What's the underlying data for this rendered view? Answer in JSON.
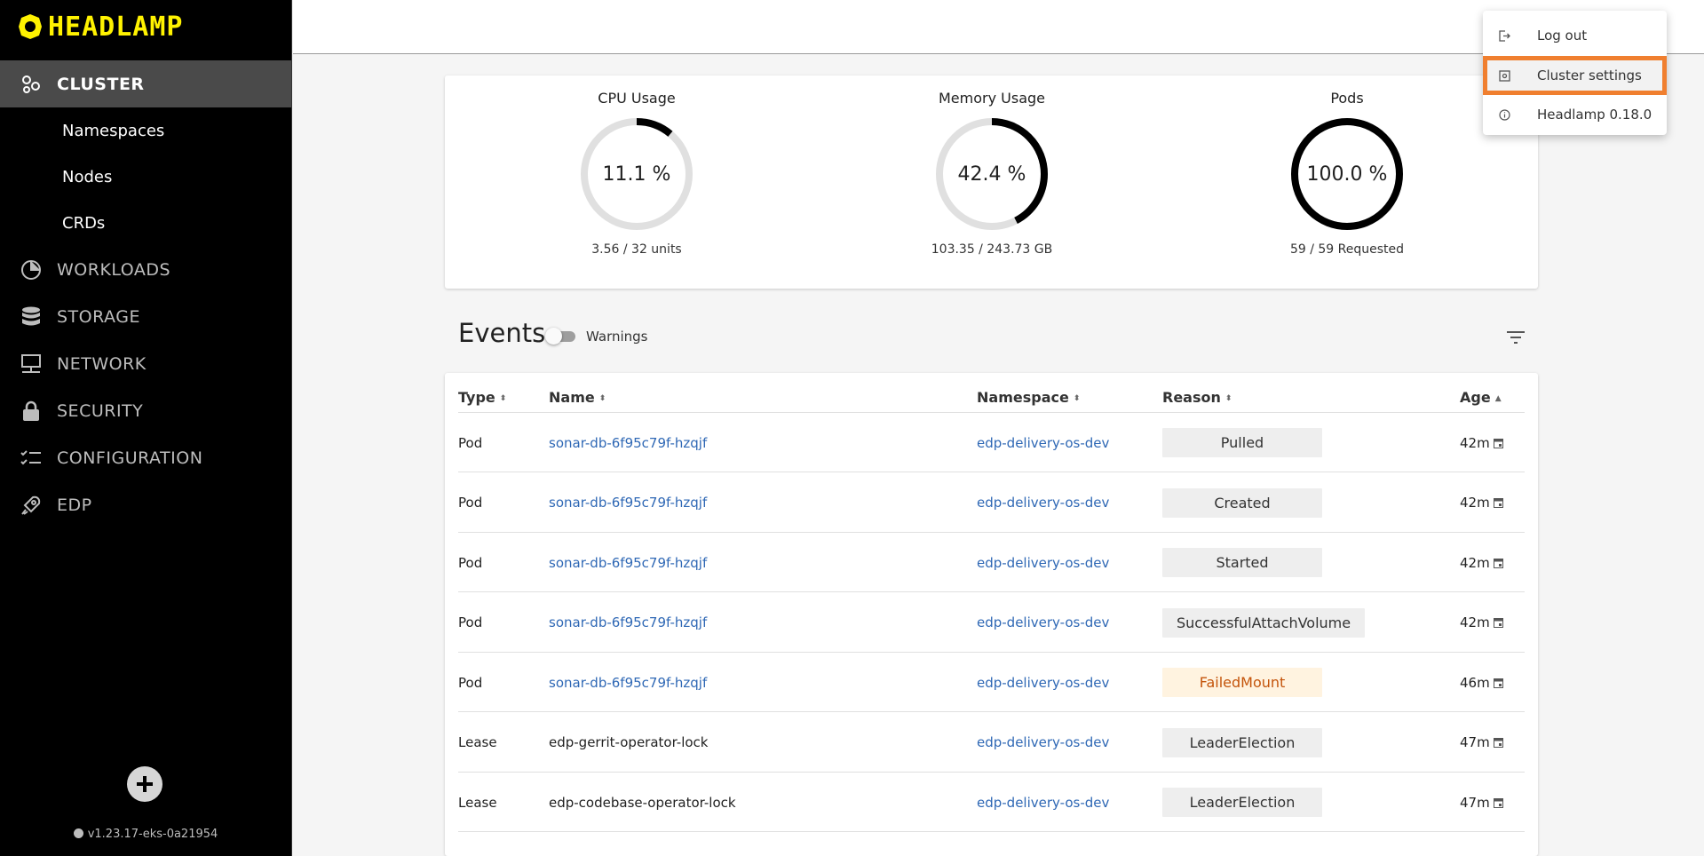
{
  "sidebar": {
    "logo": "HEADLAMP",
    "cluster_label": "CLUSTER",
    "sub_items": [
      "Namespaces",
      "Nodes",
      "CRDs"
    ],
    "items": [
      {
        "label": "WORKLOADS",
        "icon": "pie-chart-icon"
      },
      {
        "label": "STORAGE",
        "icon": "database-icon"
      },
      {
        "label": "NETWORK",
        "icon": "network-icon"
      },
      {
        "label": "SECURITY",
        "icon": "lock-icon"
      },
      {
        "label": "CONFIGURATION",
        "icon": "checklist-icon"
      },
      {
        "label": "EDP",
        "icon": "rocket-icon"
      }
    ],
    "version": "v1.23.17-eks-0a21954"
  },
  "overview": {
    "cpu": {
      "title": "CPU Usage",
      "value": "11.1 %",
      "fraction": 0.111,
      "detail": "3.56 / 32 units"
    },
    "memory": {
      "title": "Memory Usage",
      "value": "42.4 %",
      "fraction": 0.424,
      "detail": "103.35 / 243.73 GB"
    },
    "pods": {
      "title": "Pods",
      "value": "100.0 %",
      "fraction": 1.0,
      "detail": "59 / 59 Requested"
    }
  },
  "events": {
    "title": "Events",
    "warnings_label": "Warnings",
    "columns": {
      "type": "Type",
      "name": "Name",
      "namespace": "Namespace",
      "reason": "Reason",
      "age": "Age"
    },
    "rows": [
      {
        "type": "Pod",
        "name": "sonar-db-6f95c79f-hzqjf",
        "name_link": true,
        "namespace": "edp-delivery-os-dev",
        "reason": "Pulled",
        "warning": false,
        "age": "42m"
      },
      {
        "type": "Pod",
        "name": "sonar-db-6f95c79f-hzqjf",
        "name_link": true,
        "namespace": "edp-delivery-os-dev",
        "reason": "Created",
        "warning": false,
        "age": "42m"
      },
      {
        "type": "Pod",
        "name": "sonar-db-6f95c79f-hzqjf",
        "name_link": true,
        "namespace": "edp-delivery-os-dev",
        "reason": "Started",
        "warning": false,
        "age": "42m"
      },
      {
        "type": "Pod",
        "name": "sonar-db-6f95c79f-hzqjf",
        "name_link": true,
        "namespace": "edp-delivery-os-dev",
        "reason": "SuccessfulAttachVolume",
        "warning": false,
        "age": "42m"
      },
      {
        "type": "Pod",
        "name": "sonar-db-6f95c79f-hzqjf",
        "name_link": true,
        "namespace": "edp-delivery-os-dev",
        "reason": "FailedMount",
        "warning": true,
        "age": "46m"
      },
      {
        "type": "Lease",
        "name": "edp-gerrit-operator-lock",
        "name_link": false,
        "namespace": "edp-delivery-os-dev",
        "reason": "LeaderElection",
        "warning": false,
        "age": "47m"
      },
      {
        "type": "Lease",
        "name": "edp-codebase-operator-lock",
        "name_link": false,
        "namespace": "edp-delivery-os-dev",
        "reason": "LeaderElection",
        "warning": false,
        "age": "47m"
      }
    ]
  },
  "menu": {
    "items": [
      {
        "label": "Log out",
        "icon": "logout-icon"
      },
      {
        "label": "Cluster settings",
        "icon": "settings-icon"
      },
      {
        "label": "Headlamp 0.18.0",
        "icon": "info-icon"
      }
    ]
  },
  "colors": {
    "sidebar_bg": "#000000",
    "logo_yellow": "#fff200",
    "active_nav": "#4a4a4a",
    "link": "#2f68b5",
    "warning_text": "#c4540b",
    "warning_bg": "#fff3e0",
    "highlight": "#f07f2f",
    "gauge_track": "#e0e0e0",
    "gauge_fill": "#000000"
  }
}
